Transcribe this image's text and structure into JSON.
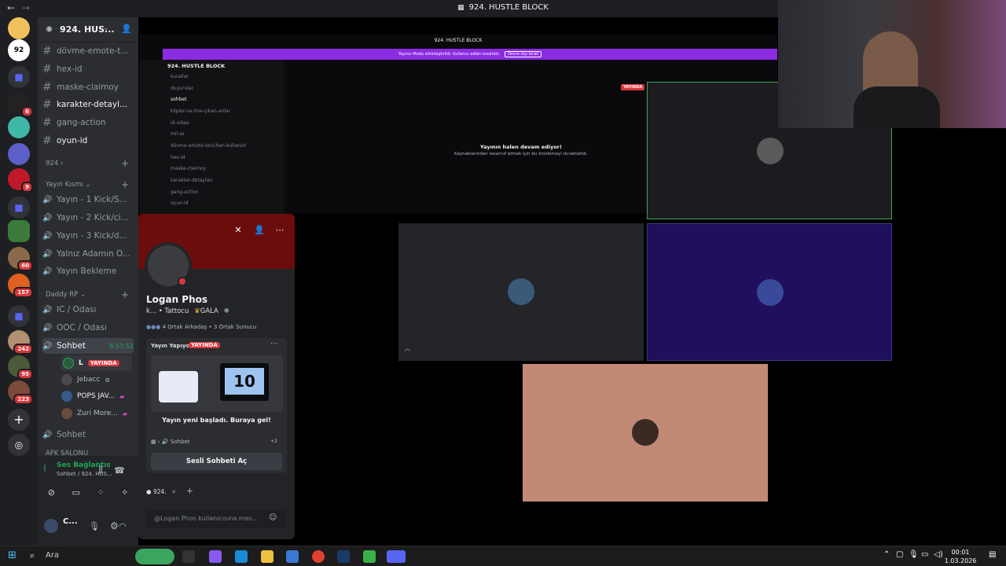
{
  "app": {
    "title": "924. HUSTLE BLOCK"
  },
  "sidebar": {
    "server_name": "924. HUS...",
    "channels": [
      {
        "label": "dövme-emote-t..."
      },
      {
        "label": "hex-id"
      },
      {
        "label": "maske-claimoy"
      },
      {
        "label": "karakter-detayl..."
      },
      {
        "label": "gang-action"
      },
      {
        "label": "oyun-id"
      }
    ],
    "category_924": "924",
    "category_yayin": "Yayın Kısmı",
    "yayin_channels": [
      {
        "label": "Yayın - 1 Kick/S..."
      },
      {
        "label": "Yayın - 2 Kick/ci..."
      },
      {
        "label": "Yayın - 3 Kick/d..."
      },
      {
        "label": "Yalnız Adamın O..."
      },
      {
        "label": "Yayın Bekleme"
      }
    ],
    "category_daddy": "Daddy RP",
    "daddy_channels": [
      {
        "label": "IC / Odası"
      },
      {
        "label": "OOC / Odası"
      }
    ],
    "sohbet": {
      "label": "Sohbet",
      "time": "8:53:52"
    },
    "voice_users": [
      {
        "name": "L",
        "badge": "YAYINDA"
      },
      {
        "name": "Jebacc"
      },
      {
        "name": "POPS JAV..."
      },
      {
        "name": "Zuri More..."
      }
    ],
    "sohbet2": "Sohbet",
    "afk": "AFK SALONU",
    "server_badges": [
      "6",
      "9",
      "60",
      "157",
      "242",
      "95",
      "223"
    ]
  },
  "voice_panel": {
    "status": "Ses Bağlantısı K...",
    "channel": "Sohbet / 924. HUS..."
  },
  "user_panel": {
    "name": "C..."
  },
  "inner": {
    "title": "924. HUSTLE BLOCK",
    "banner": "Yayıncı Modu etkinleştirildi. Kullanıcı adları kısaltıldı.",
    "banner_btn": "Devre dışı bırak",
    "server": "924. HUSTLE BLOCK",
    "channels": [
      "kurallar",
      "duyurular",
      "sohbet",
      "klipler-ve-öne-çıkan-anlar",
      "id-odası",
      "mil-ss",
      "dövme-emote-tercihen-kullanılır",
      "hex-id",
      "maske-claimoy",
      "karakter-detayları",
      "gang-action",
      "oyun-id"
    ]
  },
  "stream": {
    "live": "YAYINDA",
    "paused_title": "Yayının halen devam ediyor!",
    "paused_sub": "Kaynaklarından tasarruf etmek için bu önizlemeyi duraklattık."
  },
  "profile": {
    "name": "Logan Phos",
    "sub": "k... • Tattocu",
    "tag": "GALA",
    "mutual_friends": "4 Ortak Arkadaş",
    "mutual_servers": "3 Ortak Sunucu",
    "activity_label": "Yayın Yapıyor",
    "activity_badge": "YAYINDA",
    "countdown": "10",
    "activity_text": "Yayın yeni başladı. Buraya gel!",
    "activity_channel": "Sohbet",
    "activity_extra": "+2",
    "join_btn": "Sesli Sohbeti Aç",
    "server_chip": "924.",
    "message_placeholder": "@Logan Phos kullanıcısına mes..."
  },
  "taskbar": {
    "search": "Ara",
    "time": "00:01",
    "date": "1.03.2026"
  },
  "colors": {
    "accent": "#5865f2",
    "live": "#da373c",
    "streamer": "#8b2be2",
    "online": "#23a559"
  }
}
